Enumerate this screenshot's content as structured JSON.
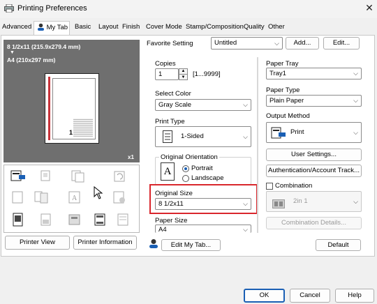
{
  "window": {
    "title": "Printing Preferences",
    "close_glyph": "✕"
  },
  "tabs": [
    {
      "label": "Advanced"
    },
    {
      "label": "My Tab"
    },
    {
      "label": "Basic"
    },
    {
      "label": "Layout"
    },
    {
      "label": "Finish"
    },
    {
      "label": "Cover Mode"
    },
    {
      "label": "Stamp/Composition"
    },
    {
      "label": "Quality"
    },
    {
      "label": "Other"
    }
  ],
  "preview": {
    "paper_line1": "8 1/2x11 (215.9x279.4 mm)",
    "arrow": "▼",
    "paper_line2": "A4 (210x297 mm)",
    "page_number": "1",
    "copies_badge": "x1"
  },
  "favorite": {
    "label": "Favorite Setting",
    "value": "Untitled",
    "add_button": "Add...",
    "edit_button": "Edit..."
  },
  "copies": {
    "label": "Copies",
    "value": "1",
    "range": "[1...9999]"
  },
  "select_color": {
    "label": "Select Color",
    "value": "Gray Scale"
  },
  "print_type": {
    "label": "Print Type",
    "value": "1-Sided"
  },
  "orientation": {
    "label": "Original Orientation",
    "portrait": "Portrait",
    "landscape": "Landscape",
    "selected": "Portrait",
    "icon_letter": "A"
  },
  "original_size": {
    "label": "Original Size",
    "value": "8 1/2x11"
  },
  "paper_size": {
    "label": "Paper Size",
    "value": "A4"
  },
  "paper_tray": {
    "label": "Paper Tray",
    "value": "Tray1"
  },
  "paper_type": {
    "label": "Paper Type",
    "value": "Plain Paper"
  },
  "output_method": {
    "label": "Output Method",
    "value": "Print"
  },
  "user_settings_button": "User Settings...",
  "auth_button": "Authentication/Account Track...",
  "combination": {
    "label": "Combination",
    "value": "2in 1",
    "details_button": "Combination Details..."
  },
  "buttons": {
    "printer_view": "Printer View",
    "printer_information": "Printer Information",
    "edit_my_tab": "Edit My Tab...",
    "default": "Default",
    "ok": "OK",
    "cancel": "Cancel",
    "help": "Help"
  },
  "colors": {
    "highlight_box": "#d9262c",
    "accent": "#1a5fb4",
    "preview_bg": "#6f6f6f"
  }
}
